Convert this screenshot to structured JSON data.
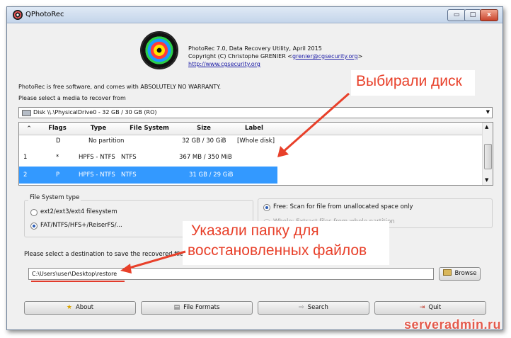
{
  "window": {
    "title": "QPhotoRec",
    "min": "▭",
    "max": "□",
    "close": "x"
  },
  "header": {
    "line1": "PhotoRec 7.0, Data Recovery Utility, April 2015",
    "line2": "Copyright (C) Christophe GRENIER <",
    "email": "grenier@cgsecurity.org",
    "line2_end": ">",
    "url": "http://www.cgsecurity.org"
  },
  "intro": {
    "free_software": "PhotoRec is free software, and comes with ABSOLUTELY NO WARRANTY.",
    "select_media": "Please select a media to recover from"
  },
  "media_combo": {
    "value": "Disk \\\\.\\PhysicalDrive0 - 32 GB / 30 GB (RO)"
  },
  "table": {
    "headers": [
      "",
      "Flags",
      "Type",
      "File System",
      "Size",
      "Label"
    ],
    "rows": [
      {
        "num": "",
        "flags": "D",
        "type": "No partition",
        "fs": "",
        "size": "32 GB / 30 GiB",
        "label": "[Whole disk]"
      },
      {
        "num": "1",
        "flags": "*",
        "type": "HPFS - NTFS",
        "fs": "NTFS",
        "size": "367 MB / 350 MiB",
        "label": ""
      },
      {
        "num": "2",
        "flags": "P",
        "type": "HPFS - NTFS",
        "fs": "NTFS",
        "size": "31 GB / 29 GiB",
        "label": ""
      }
    ]
  },
  "fs_type": {
    "title": "File System type",
    "opt1": "ext2/ext3/ext4 filesystem",
    "opt2": "FAT/NTFS/HFS+/ReiserFS/..."
  },
  "scan": {
    "free": "Free: Scan for file from unallocated space only",
    "whole": "Whole: Extract files from whole partition"
  },
  "destination": {
    "label": "Please select a destination to save the recovered files.",
    "value": "C:\\Users\\user\\Desktop\\restore",
    "browse": "Browse"
  },
  "buttons": {
    "about": "About",
    "formats": "File Formats",
    "search": "Search",
    "quit": "Quit"
  },
  "annotations": {
    "disk": "Выбирали диск",
    "folder_line1": "Указали папку для",
    "folder_line2": "восстановленных файлов"
  },
  "watermark": "serveradmin.ru",
  "colors": {
    "selection": "#3399ff",
    "arrow": "#e8402a",
    "underline": "#e23a2a"
  }
}
